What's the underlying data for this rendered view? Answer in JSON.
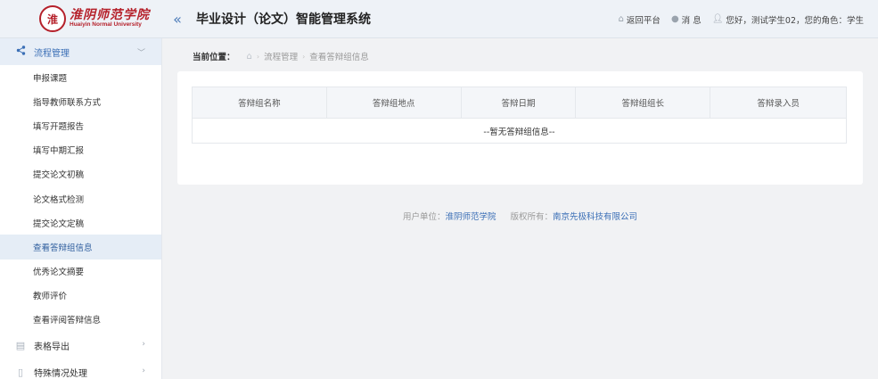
{
  "header": {
    "logo_seal": "淮",
    "logo_cn": "淮阴师范学院",
    "logo_en": "Huaiyin Normal University",
    "collapse": "«",
    "title": "毕业设计（论文）智能管理系统",
    "back": "返回平台",
    "messages": "消 息",
    "greeting": "您好，测试学生02，您的角色：学生"
  },
  "sidebar": {
    "group_process": "流程管理",
    "items": [
      "申报课题",
      "指导教师联系方式",
      "填写开题报告",
      "填写中期汇报",
      "提交论文初稿",
      "论文格式检测",
      "提交论文定稿",
      "查看答辩组信息",
      "优秀论文摘要",
      "教师评价",
      "查看评阅答辩信息"
    ],
    "active_index": 7,
    "group_export": "表格导出",
    "group_special": "特殊情况处理"
  },
  "breadcrumb": {
    "label": "当前位置：",
    "level1": "流程管理",
    "level2": "查看答辩组信息"
  },
  "table": {
    "columns": [
      "答辩组名称",
      "答辩组地点",
      "答辩日期",
      "答辩组组长",
      "答辩录入员"
    ],
    "empty": "--暂无答辩组信息--"
  },
  "footer": {
    "unit_label": "用户单位：",
    "unit": "淮阴师范学院",
    "copyright_label": "版权所有：",
    "company": "南京先极科技有限公司"
  }
}
